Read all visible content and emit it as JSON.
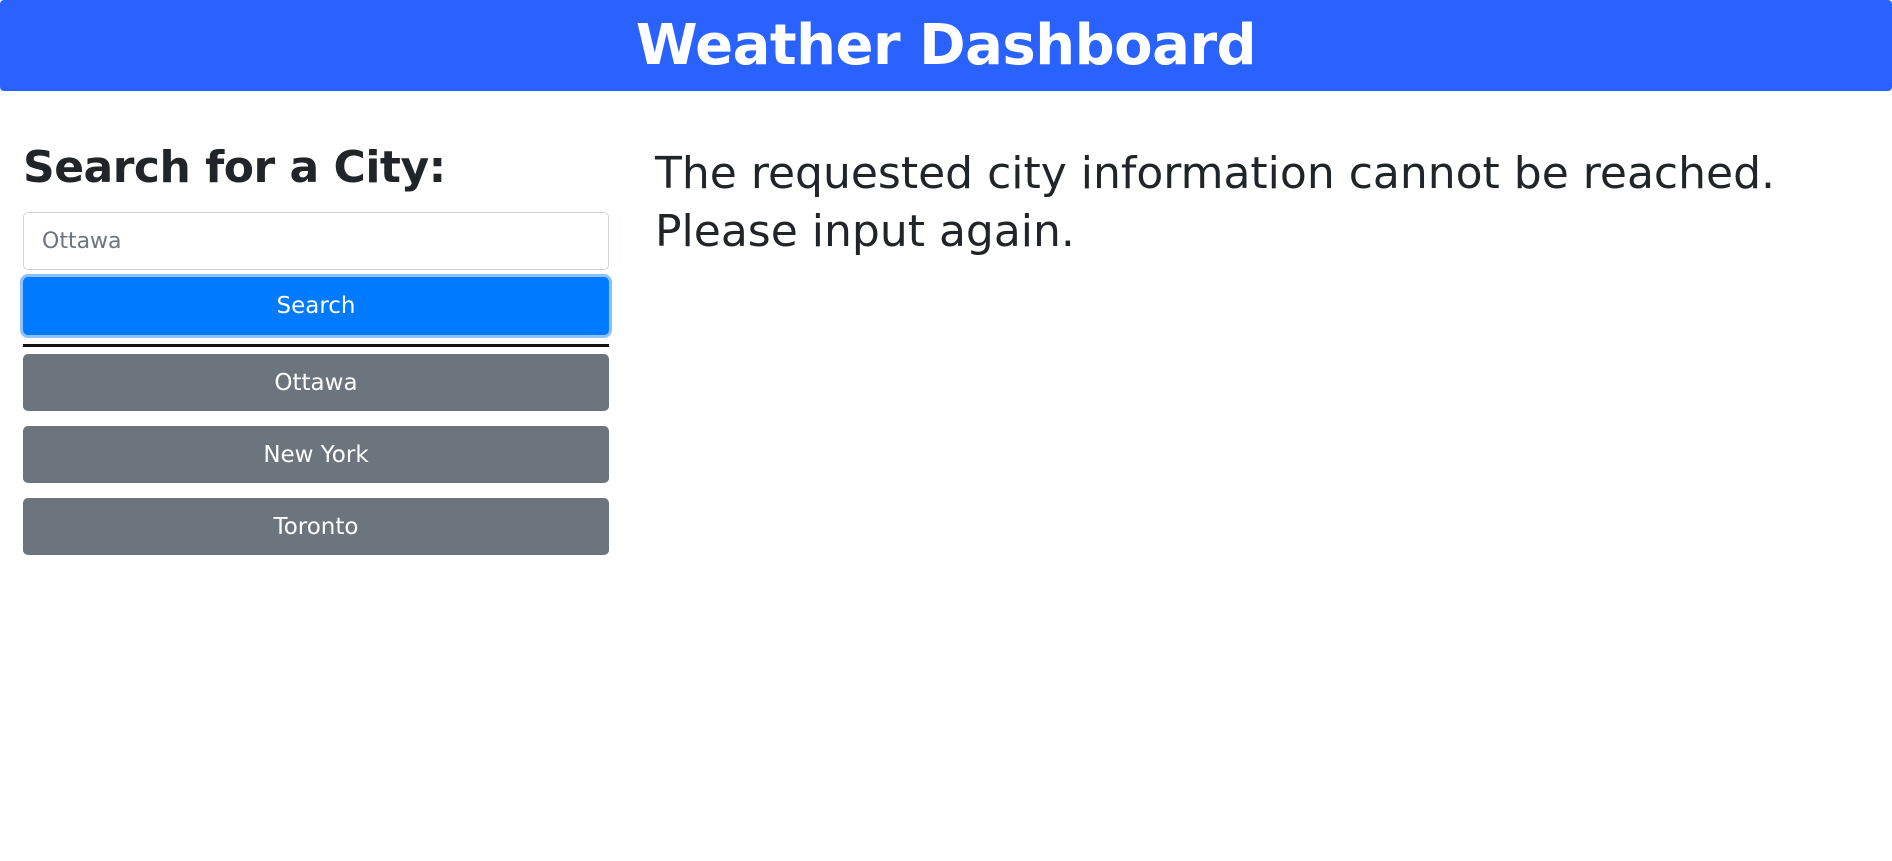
{
  "header": {
    "title": "Weather Dashboard"
  },
  "sidebar": {
    "heading": "Search for a City:",
    "search_input": {
      "value": "",
      "placeholder": "Ottawa"
    },
    "search_button_label": "Search",
    "history": [
      {
        "label": "Ottawa"
      },
      {
        "label": "New York"
      },
      {
        "label": "Toronto"
      }
    ]
  },
  "main": {
    "error_line_1": "The requested city information cannot be reached.",
    "error_line_2": "Please input again."
  },
  "colors": {
    "header_bg": "#2962ff",
    "primary_button": "#007bff",
    "secondary_button": "#6c757d",
    "text": "#212529"
  }
}
